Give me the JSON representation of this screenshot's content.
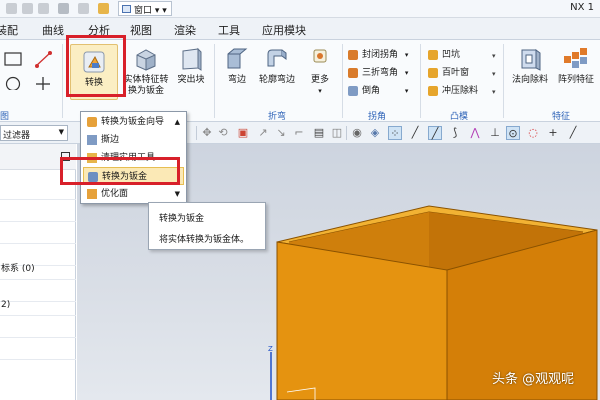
{
  "titlebar": {
    "app_title": "NX 1",
    "window_menu": "窗口"
  },
  "tabs": [
    "装配",
    "曲线",
    "分析",
    "视图",
    "渲染",
    "工具",
    "应用模块"
  ],
  "ribbon": {
    "convert_button": "转换",
    "solid_feature_button_line1": "实体特征转",
    "solid_feature_button_line2": "换为钣金",
    "bump_button": "突出块",
    "flange_button": "弯边",
    "contour_flange_button": "轮廓弯边",
    "more_button": "更多",
    "closed_corner": "封闭拐角",
    "three_bend_corner": "三折弯角",
    "chamfer": "倒角",
    "dimple": "凹坑",
    "louver": "百叶窗",
    "punch_trim": "冲压除料",
    "normal_cutout_button": "法向除料",
    "array_feature_button": "阵列特征",
    "group_labels": {
      "sketch_partial": "图",
      "bend": "折弯",
      "corner": "拐角",
      "punch": "凸模",
      "feature": "特征"
    }
  },
  "filter": {
    "value": "过滤器"
  },
  "navigator": {
    "rows": [
      "",
      "",
      "",
      "",
      "标系 (0)",
      "",
      "2)",
      "",
      ""
    ]
  },
  "dropdown": {
    "items": [
      "转换为钣金向导",
      "撕边",
      "清理实用工具",
      "转换为钣金",
      "优化面"
    ]
  },
  "tooltip": {
    "title": "转换为钣金",
    "description": "将实体转换为钣金体。"
  },
  "watermark": "头条 @观观呢",
  "colors": {
    "highlight_frame": "#d8202a",
    "model_orange": "#e08a06",
    "link_blue": "#2e63b8"
  }
}
